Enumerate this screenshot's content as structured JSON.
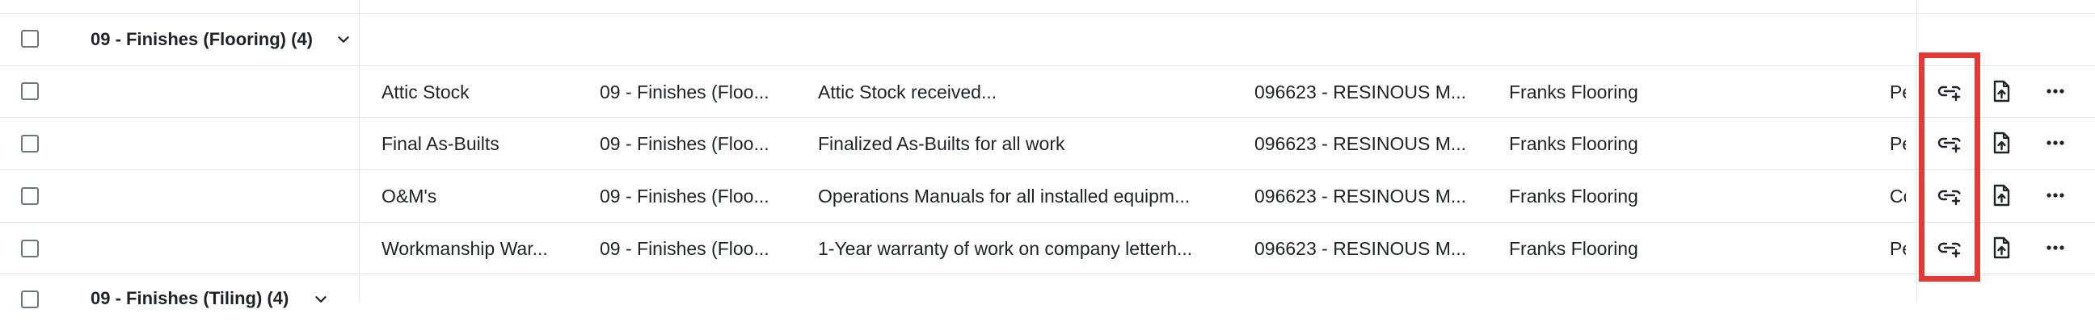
{
  "groups": [
    {
      "label": "09 - Finishes (Flooring) (4)"
    },
    {
      "label": "09 - Finishes (Tiling) (4)"
    }
  ],
  "rows": [
    {
      "title": "Attic Stock",
      "spec_section": "09 - Finishes (Floo...",
      "description": "Attic Stock received...",
      "spec_item": "096623 - RESINOUS M...",
      "company": "Franks Flooring",
      "status": "Pe"
    },
    {
      "title": "Final As-Builts",
      "spec_section": "09 - Finishes (Floo...",
      "description": "Finalized As-Builts for all work",
      "spec_item": "096623 - RESINOUS M...",
      "company": "Franks Flooring",
      "status": "Pe"
    },
    {
      "title": "O&M's",
      "spec_section": "09 - Finishes (Floo...",
      "description": "Operations Manuals for all installed equipm...",
      "spec_item": "096623 - RESINOUS M...",
      "company": "Franks Flooring",
      "status": "Co"
    },
    {
      "title": "Workmanship War...",
      "spec_section": "09 - Finishes (Floo...",
      "description": "1-Year warranty of work on company letterh...",
      "spec_item": "096623 - RESINOUS M...",
      "company": "Franks Flooring",
      "status": "Pe"
    }
  ],
  "icons": {
    "link": "link-add-icon",
    "upload": "file-upload-icon",
    "more": "more-horizontal-icon",
    "expand": "chevron-down-icon"
  },
  "colors": {
    "highlight": "#e53935",
    "border": "#e3e6e8",
    "text": "#1f2328"
  }
}
